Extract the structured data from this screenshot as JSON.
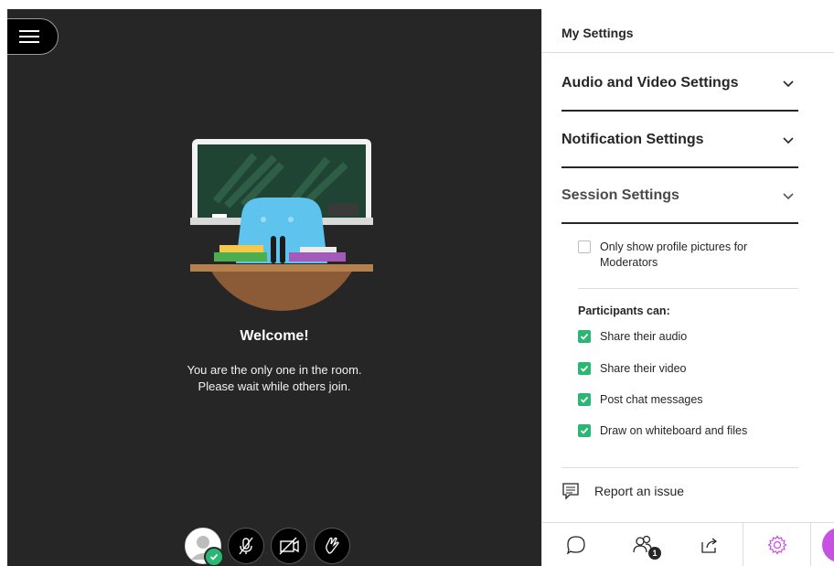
{
  "stage": {
    "menu_icon": "hamburger-icon",
    "welcome_title": "Welcome!",
    "welcome_line1": "You are the only one in the room.",
    "welcome_line2": "Please wait while others join.",
    "controls": [
      {
        "name": "avatar",
        "icon": "user-avatar-icon"
      },
      {
        "name": "microphone",
        "icon": "mic-off-icon"
      },
      {
        "name": "camera",
        "icon": "camera-off-icon"
      },
      {
        "name": "raise-hand",
        "icon": "hand-icon"
      }
    ]
  },
  "panel": {
    "title": "My Settings",
    "sections": [
      {
        "label": "Audio and Video Settings"
      },
      {
        "label": "Notification Settings"
      },
      {
        "label": "Session Settings"
      }
    ],
    "session": {
      "profile_pictures_label": "Only show profile pictures for Moderators",
      "profile_pictures_checked": false,
      "participants_label": "Participants can:",
      "permissions": [
        {
          "label": "Share their audio",
          "checked": true
        },
        {
          "label": "Share their video",
          "checked": true
        },
        {
          "label": "Post chat messages",
          "checked": true
        },
        {
          "label": "Draw on whiteboard and files",
          "checked": true
        }
      ]
    },
    "report_label": "Report an issue",
    "tabs": [
      {
        "name": "chat",
        "icon": "chat-icon"
      },
      {
        "name": "attendees",
        "icon": "attendees-icon",
        "badge": "1"
      },
      {
        "name": "share",
        "icon": "share-icon"
      },
      {
        "name": "settings",
        "icon": "gear-icon",
        "active": true
      }
    ]
  },
  "colors": {
    "stage_bg": "#262626",
    "check_green": "#2bb673",
    "active_tab": "#c751e0"
  }
}
